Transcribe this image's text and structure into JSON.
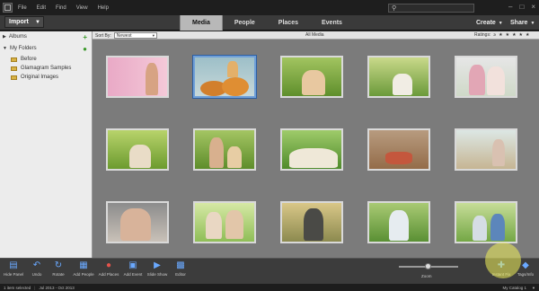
{
  "titlebar": {
    "menu": [
      "File",
      "Edit",
      "Find",
      "View",
      "Help"
    ],
    "search_icon": "search-icon",
    "controls": [
      "–",
      "□",
      "×"
    ]
  },
  "toolbar": {
    "import_label": "Import",
    "tabs": [
      "Media",
      "People",
      "Places",
      "Events"
    ],
    "active_tab": "Media",
    "create_label": "Create",
    "share_label": "Share"
  },
  "leftpanel": {
    "albums_label": "Albums",
    "folders_label": "My Folders",
    "folders": [
      "Before",
      "Glamagram Samples",
      "Original Images"
    ]
  },
  "subbar": {
    "sort_label": "Sort By:",
    "sort_value": "Newest",
    "view_label": "All Media",
    "ratings_label": "Ratings:"
  },
  "dock": {
    "items": [
      "Hide Panel",
      "Undo",
      "Rotate",
      "Add People",
      "Add Places",
      "Add Event",
      "Slide Show",
      "Editor"
    ],
    "zoom_label": "Zoom",
    "instant_fix_label": "Instant Fix",
    "tags_info_label": "Tags/Info"
  },
  "status": {
    "selection_text": "1 item selected",
    "date_range": "Jul 2013 - Oct 2013",
    "catalog_text": "My Catalog 1"
  },
  "colors": {
    "active_tab": "#b8b8b8",
    "grid_bg": "#7b7b7b",
    "accent_blue": "#6aa9ff"
  }
}
